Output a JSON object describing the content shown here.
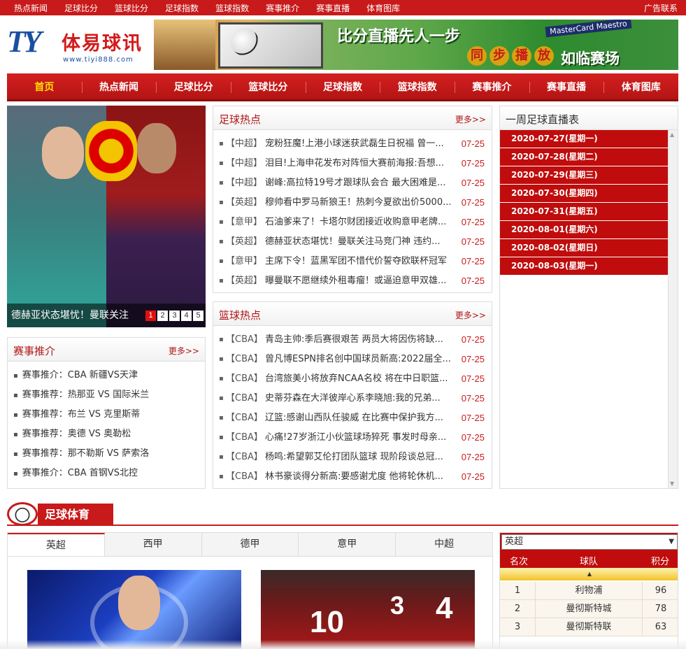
{
  "topbar": {
    "links": [
      "热点新闻",
      "足球比分",
      "篮球比分",
      "足球指数",
      "篮球指数",
      "赛事推介",
      "赛事直播",
      "体育图库"
    ],
    "right": "广告联系"
  },
  "logo": {
    "mark": "TY",
    "name": "体易球讯",
    "url": "www.tiyi888.com"
  },
  "banner": {
    "headline": "比分直播先人一步",
    "chars": [
      "同",
      "步",
      "播",
      "放"
    ],
    "tail": "如临赛场",
    "sponsor": "MasterCard Maestro"
  },
  "nav": {
    "items": [
      "首页",
      "热点新闻",
      "足球比分",
      "篮球比分",
      "足球指数",
      "篮球指数",
      "赛事推介",
      "赛事直播",
      "体育图库"
    ],
    "active": "首页"
  },
  "slider": {
    "caption": "德赫亚状态堪忧！曼联关注",
    "pages": [
      "1",
      "2",
      "3",
      "4",
      "5"
    ],
    "current": "1"
  },
  "recommend": {
    "title": "赛事推介",
    "more": "更多>>",
    "items": [
      "赛事推介：CBA 新疆VS天津",
      "赛事推荐：热那亚 VS 国际米兰",
      "赛事推荐：布兰 VS 克里斯蒂",
      "赛事推荐：奥德 VS 奥勒松",
      "赛事推荐：那不勒斯 VS 萨索洛",
      "赛事推介：CBA 首钢VS北控"
    ]
  },
  "football_news": {
    "title": "足球热点",
    "more": "更多>>",
    "items": [
      {
        "tag": "【中超】",
        "title": "宠粉狂魔!上港小球迷获武磊生日祝福 曾一...",
        "date": "07-25"
      },
      {
        "tag": "【中超】",
        "title": "泪目!上海申花发布对阵恒大赛前海报:吾想...",
        "date": "07-25"
      },
      {
        "tag": "【中超】",
        "title": "谢峰:高拉特19号才跟球队会合 最大困难是...",
        "date": "07-25"
      },
      {
        "tag": "【英超】",
        "title": "穆帅看中罗马新狼王！热刺今夏欲出价5000...",
        "date": "07-25"
      },
      {
        "tag": "【意甲】",
        "title": "石油爹来了！卡塔尔财团接近收购意甲老牌...",
        "date": "07-25"
      },
      {
        "tag": "【英超】",
        "title": "德赫亚状态堪忧！曼联关注马竞门神 违约...",
        "date": "07-25"
      },
      {
        "tag": "【意甲】",
        "title": "主席下令！蓝黑军团不惜代价誓夺欧联杯冠军",
        "date": "07-25"
      },
      {
        "tag": "【英超】",
        "title": "曝曼联不愿继续外租毒瘤！或逼迫意甲双雄...",
        "date": "07-25"
      }
    ]
  },
  "basketball_news": {
    "title": "篮球热点",
    "more": "更多>>",
    "items": [
      {
        "tag": "【CBA】",
        "title": "青岛主帅:季后赛很艰苦 两员大将因伤将缺...",
        "date": "07-25"
      },
      {
        "tag": "【CBA】",
        "title": "曾凡博ESPN排名创中国球员新高:2022届全...",
        "date": "07-25"
      },
      {
        "tag": "【CBA】",
        "title": "台湾旅美小将放弃NCAA名校 将在中日职篮...",
        "date": "07-25"
      },
      {
        "tag": "【CBA】",
        "title": "史蒂芬森在大洋彼岸心系李晓旭:我的兄弟...",
        "date": "07-25"
      },
      {
        "tag": "【CBA】",
        "title": "辽篮:感谢山西队任骏威 在比赛中保护我方...",
        "date": "07-25"
      },
      {
        "tag": "【CBA】",
        "title": "心痛!27岁浙江小伙篮球场猝死 事发时母亲...",
        "date": "07-25"
      },
      {
        "tag": "【CBA】",
        "title": "杨鸣:希望郭艾伦打团队篮球 现阶段谈总冠...",
        "date": "07-25"
      },
      {
        "tag": "【CBA】",
        "title": "林书豪谈得分新高:要感谢尤度 他将轮休机...",
        "date": "07-25"
      }
    ]
  },
  "schedule": {
    "title": "一周足球直播表",
    "days": [
      "2020-07-27(星期一)",
      "2020-07-28(星期二)",
      "2020-07-29(星期三)",
      "2020-07-30(星期四)",
      "2020-07-31(星期五)",
      "2020-08-01(星期六)",
      "2020-08-02(星期日)",
      "2020-08-03(星期一)"
    ]
  },
  "section": {
    "title": "足球体育"
  },
  "league_tabs": {
    "items": [
      "英超",
      "西甲",
      "德甲",
      "意甲",
      "中超"
    ],
    "active": "英超"
  },
  "standings": {
    "selected": "英超",
    "headers": [
      "名次",
      "球队",
      "积分"
    ],
    "rows": [
      {
        "rank": "1",
        "team": "利物浦",
        "points": "96"
      },
      {
        "rank": "2",
        "team": "曼彻斯特城",
        "points": "78"
      },
      {
        "rank": "3",
        "team": "曼彻斯特联",
        "points": "63"
      }
    ]
  },
  "colors": {
    "brand_red": "#c81a1a",
    "highlight_yellow": "#ffe000",
    "logo_blue": "#1a4fa0"
  }
}
